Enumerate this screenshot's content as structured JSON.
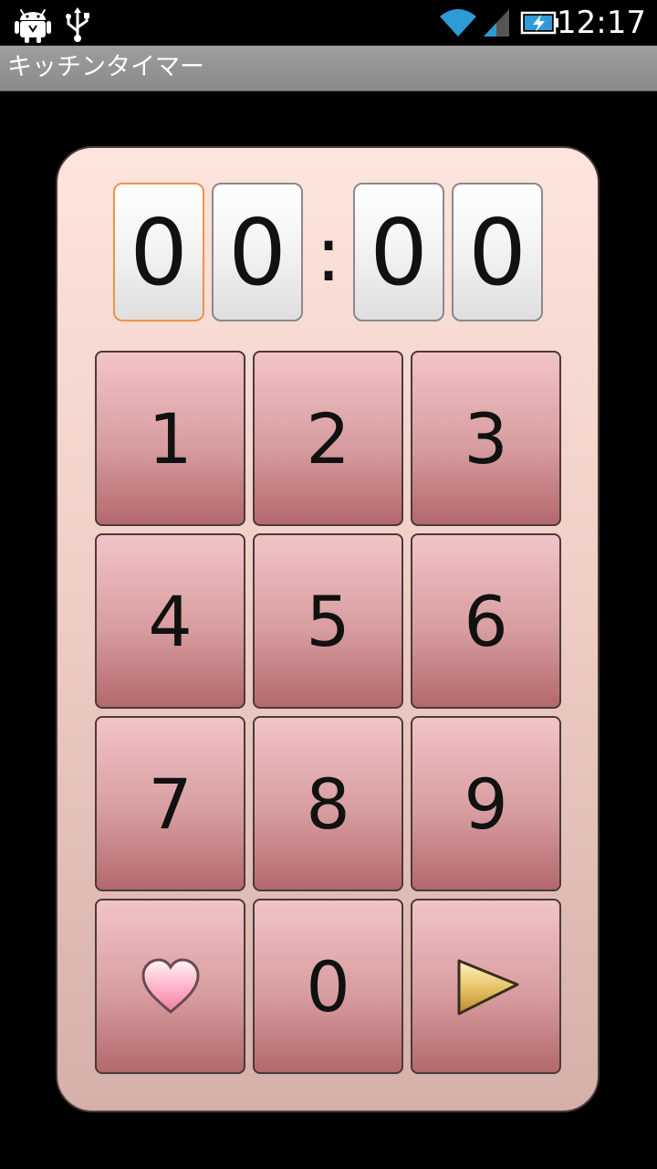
{
  "status_bar": {
    "time": "12:17",
    "icons": [
      "android-debug-icon",
      "usb-icon",
      "wifi-icon",
      "cell-signal-icon",
      "battery-charging-icon"
    ]
  },
  "app": {
    "title": "キッチンタイマー"
  },
  "timer": {
    "digits": [
      "0",
      "0",
      "0",
      "0"
    ],
    "separator": ":",
    "active_digit_index": 0
  },
  "keypad": {
    "keys": [
      "1",
      "2",
      "3",
      "4",
      "5",
      "6",
      "7",
      "8",
      "9",
      "0"
    ],
    "favorite_icon": "heart-icon",
    "start_icon": "play-icon"
  },
  "colors": {
    "panel_top": "#fde5dd",
    "panel_bottom": "#d4b0a8",
    "key_top": "#f2c4c6",
    "key_bottom": "#b3686c",
    "active_digit_border": "#f0924a"
  }
}
